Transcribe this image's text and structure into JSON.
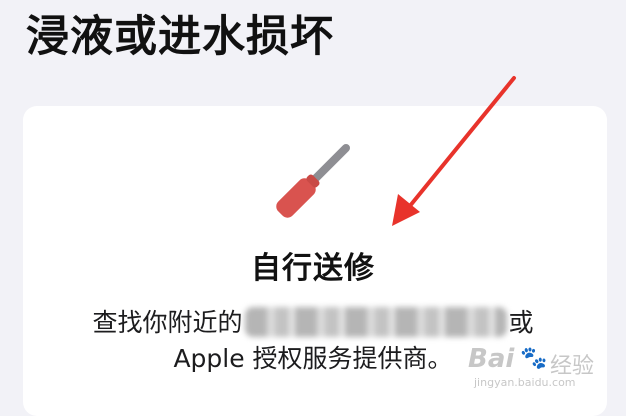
{
  "header": {
    "title": "浸液或进水损坏"
  },
  "card": {
    "icon": "screwdriver-icon",
    "option_title": "自行送修",
    "description_part1": "查找你附近的",
    "description_part1_end": "或",
    "description_line2": "Apple 授权服务提供商。"
  },
  "annotation": {
    "arrow_color": "#e8332b"
  },
  "watermark": {
    "logo": "Bai",
    "paw": "🐾",
    "brand": "经验",
    "url": "jingyan.baidu.com"
  },
  "colors": {
    "background": "#f2f2f7",
    "card": "#ffffff",
    "icon_red": "#d9534f",
    "icon_gray": "#8e8e93"
  }
}
